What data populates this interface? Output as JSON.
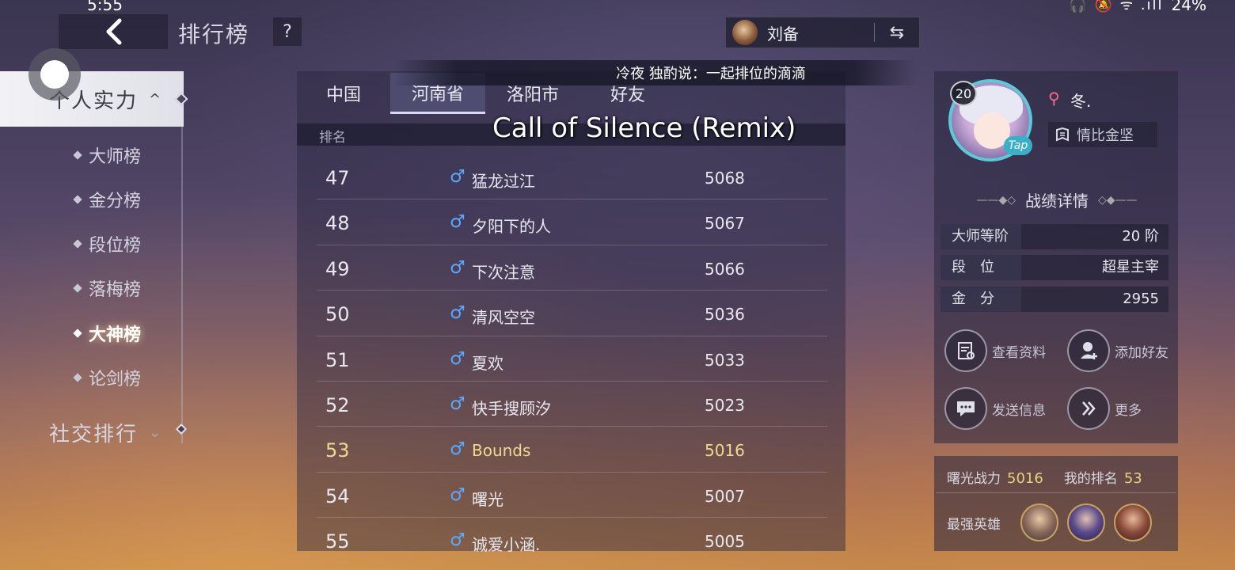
{
  "status_bar": {
    "time": "5:55",
    "icons": "🎧 🔕 ᯤ .ıll",
    "battery": "24%"
  },
  "header": {
    "title": "排行榜",
    "help": "?",
    "hero_name": "刘备",
    "swap_symbol": "⇆"
  },
  "broadcast": "冷夜 独酌说：一起排位的滴滴",
  "music_overlay": "Call of Silence (Remix)",
  "sidebar": {
    "section_active": "个人实力",
    "items": [
      {
        "label": "大师榜"
      },
      {
        "label": "金分榜"
      },
      {
        "label": "段位榜"
      },
      {
        "label": "落梅榜"
      },
      {
        "label": "大神榜",
        "active": true
      },
      {
        "label": "论剑榜"
      }
    ],
    "section_collapsed": "社交排行"
  },
  "tabs": [
    {
      "label": "中国"
    },
    {
      "label": "河南省",
      "active": true
    },
    {
      "label": "洛阳市"
    },
    {
      "label": "好友"
    }
  ],
  "table": {
    "header_rank": "排名",
    "rows": [
      {
        "rank": "47",
        "gender": "♂",
        "name": "猛龙过江",
        "score": "5068"
      },
      {
        "rank": "48",
        "gender": "♂",
        "name": "夕阳下的人",
        "score": "5067"
      },
      {
        "rank": "49",
        "gender": "♂",
        "name": "下次注意",
        "score": "5066"
      },
      {
        "rank": "50",
        "gender": "♂",
        "name": "清风空空",
        "score": "5036"
      },
      {
        "rank": "51",
        "gender": "♂",
        "name": "夏欢",
        "score": "5033"
      },
      {
        "rank": "52",
        "gender": "♂",
        "name": "快手搜顾汐",
        "score": "5023"
      },
      {
        "rank": "53",
        "gender": "♂",
        "name": "Bounds",
        "score": "5016",
        "me": true
      },
      {
        "rank": "54",
        "gender": "♂",
        "name": "曙光",
        "score": "5007"
      },
      {
        "rank": "55",
        "gender": "♂",
        "name": "诚爱小涵.",
        "score": "5005"
      }
    ]
  },
  "profile": {
    "level": "20",
    "tap": "Tap",
    "gender": "⚲",
    "name": "冬.",
    "title": "情比金坚",
    "section_title": "战绩详情",
    "stats": [
      {
        "key": "大师等阶",
        "value": "20 阶"
      },
      {
        "key": "段　位",
        "value": "超星主宰"
      },
      {
        "key": "金　分",
        "value": "2955"
      }
    ],
    "actions": [
      {
        "label": "查看资料",
        "icon": "profile-doc-icon"
      },
      {
        "label": "添加好友",
        "icon": "add-friend-icon"
      },
      {
        "label": "发送信息",
        "icon": "chat-icon"
      },
      {
        "label": "更多",
        "icon": "double-chevron-icon"
      }
    ]
  },
  "power": {
    "label": "曙光战力",
    "value": "5016",
    "rank_label": "我的排名",
    "rank_value": "53",
    "best_heroes_label": "最强英雄"
  },
  "colors": {
    "accent_gold": "#f0d890",
    "male_blue": "#5aa8ff",
    "female_pink": "#ff6a8a",
    "avatar_ring": "#5cc8d8"
  }
}
